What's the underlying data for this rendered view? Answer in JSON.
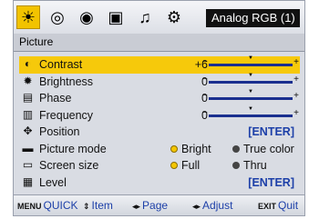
{
  "topbar": {
    "icons": [
      "picture-tab-icon",
      "image-adjust-tab-icon",
      "video-tab-icon",
      "display-tab-icon",
      "audio-tab-icon",
      "setup-tab-icon"
    ],
    "source_label": "Analog RGB (1)"
  },
  "section_title": "Picture",
  "rows": [
    {
      "label": "Contrast",
      "value": "+6",
      "slider_min": "−",
      "slider_max": "+",
      "icon": "contrast-icon"
    },
    {
      "label": "Brightness",
      "value": "0",
      "slider_min": "−",
      "slider_max": "+",
      "icon": "brightness-icon"
    },
    {
      "label": "Phase",
      "value": "0",
      "slider_min": "−",
      "slider_max": "+",
      "icon": "phase-icon"
    },
    {
      "label": "Frequency",
      "value": "0",
      "slider_min": "−",
      "slider_max": "+",
      "icon": "frequency-icon"
    },
    {
      "label": "Position",
      "action": "[ENTER]",
      "icon": "position-icon"
    },
    {
      "label": "Picture mode",
      "opt1": "Bright",
      "opt2": "True color",
      "icon": "picture-mode-icon"
    },
    {
      "label": "Screen size",
      "opt1": "Full",
      "opt2": "Thru",
      "icon": "screen-size-icon"
    },
    {
      "label": "Level",
      "action": "[ENTER]",
      "icon": "level-icon"
    }
  ],
  "bottombar": {
    "quick": "QUICK",
    "quick_key": "MENU",
    "item": "Item",
    "page": "Page",
    "adjust": "Adjust",
    "quit": "Quit",
    "quit_key": "EXIT"
  },
  "colors": {
    "highlight": "#f6c90b",
    "accent": "#1c3fa8"
  }
}
